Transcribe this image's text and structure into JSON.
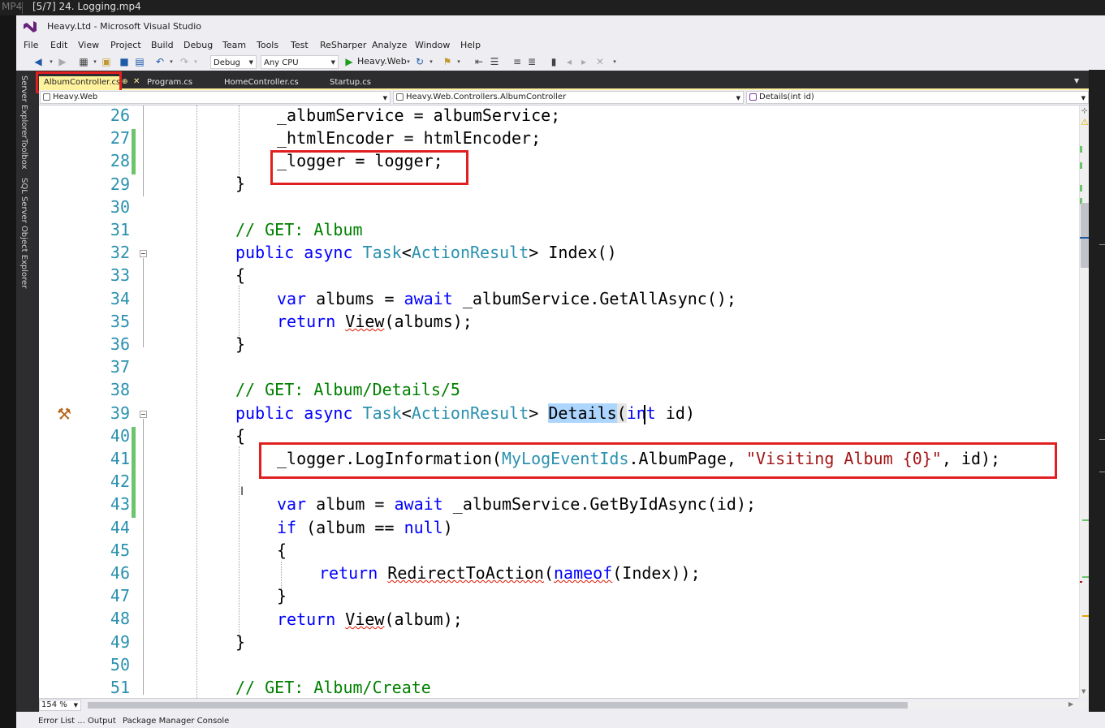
{
  "player": {
    "format": "MP4",
    "title": "[5/7] 24. Logging.mp4"
  },
  "window": {
    "title": "Heavy.Ltd - Microsoft Visual Studio"
  },
  "menu": [
    "File",
    "Edit",
    "View",
    "Project",
    "Build",
    "Debug",
    "Team",
    "Tools",
    "Test",
    "ReSharper",
    "Analyze",
    "Window",
    "Help"
  ],
  "toolbar": {
    "configuration": "Debug",
    "platform": "Any CPU",
    "startup": "Heavy.Web"
  },
  "tool_windows": [
    "Server Explorer",
    "Toolbox",
    "SQL Server Object Explorer"
  ],
  "tabs": [
    {
      "label": "AlbumController.cs",
      "active": true
    },
    {
      "label": "Program.cs",
      "active": false
    },
    {
      "label": "HomeController.cs",
      "active": false
    },
    {
      "label": "Startup.cs",
      "active": false
    }
  ],
  "navbar": {
    "project": "Heavy.Web",
    "type": "Heavy.Web.Controllers.AlbumController",
    "member": "Details(int id)"
  },
  "editor": {
    "line_numbers": [
      "26",
      "27",
      "28",
      "29",
      "30",
      "31",
      "32",
      "33",
      "34",
      "35",
      "36",
      "37",
      "38",
      "39",
      "40",
      "41",
      "42",
      "43",
      "44",
      "45",
      "46",
      "47",
      "48",
      "49",
      "50",
      "51"
    ],
    "lines": {
      "l26": "_albumService = albumService;",
      "l27": "_htmlEncoder = htmlEncoder;",
      "l28": "_logger = logger;",
      "l29": "}",
      "l31": "// GET: Album",
      "l32_kw": "public async",
      "l32_type1": "Task",
      "l32_type2": "ActionResult",
      "l32_name": "Index()",
      "l33": "{",
      "l34_kw": "var",
      "l34_a": "albums =",
      "l34_kw2": "await",
      "l34_b": "_albumService.GetAllAsync();",
      "l35_kw": "return",
      "l35_view": "View",
      "l35_rest": "(albums);",
      "l36": "}",
      "l38": "// GET: Album/Details/5",
      "l39_kw": "public async",
      "l39_type1": "Task",
      "l39_type2": "ActionResult",
      "l39_name": "Details",
      "l39_kw2": "int",
      "l39_param": "id)",
      "l40": "{",
      "l41_a": "_logger.LogInformation(",
      "l41_type": "MyLogEventIds",
      "l41_b": ".AlbumPage, ",
      "l41_str": "\"Visiting Album {0}\"",
      "l41_c": ", id);",
      "l43_kw": "var",
      "l43_a": "album =",
      "l43_kw2": "await",
      "l43_b": "_albumService.GetByIdAsync(id);",
      "l44_kw": "if",
      "l44_a": "(album ==",
      "l44_kw2": "null",
      "l44_b": ")",
      "l45": "{",
      "l46_kw": "return",
      "l46_fn": "RedirectToAction",
      "l46_kw2": "nameof",
      "l46_rest": "(Index));",
      "l47": "}",
      "l48_kw": "return",
      "l48_view": "View",
      "l48_rest": "(album);",
      "l49": "}",
      "l51": "// GET: Album/Create"
    },
    "zoom": "154 %"
  },
  "bottom_tabs": [
    "Error List ...",
    "Output",
    "Package Manager Console"
  ],
  "colors": {
    "keyword": "#0000ff",
    "type": "#2b91af",
    "comment": "#008000",
    "string": "#a31515",
    "highlight_box": "#e02020",
    "active_tab": "#fff29d"
  }
}
